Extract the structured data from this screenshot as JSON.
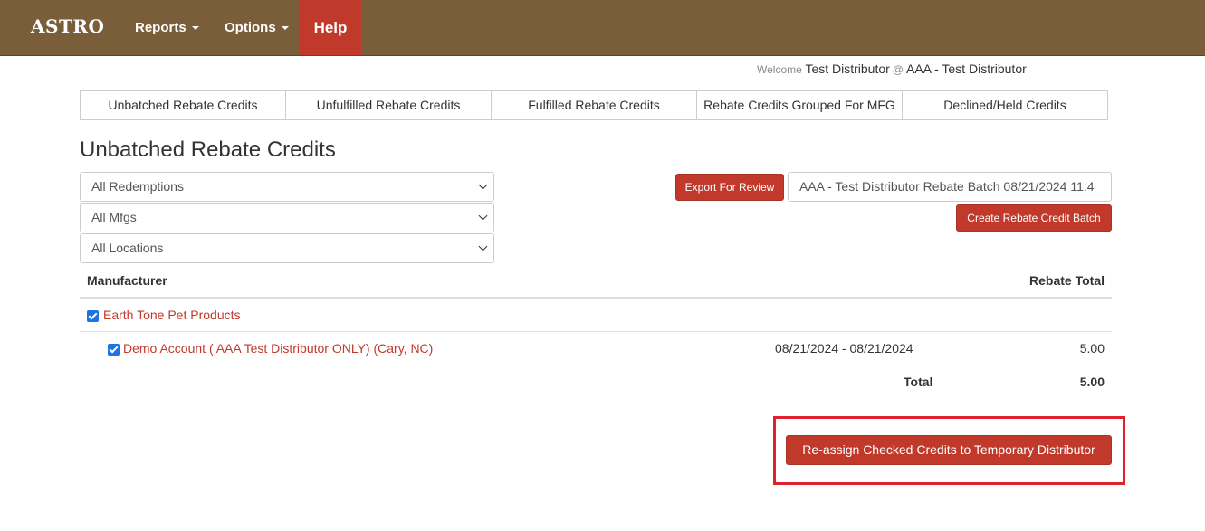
{
  "nav": {
    "brand": "ASTRO",
    "reports": "Reports",
    "options": "Options",
    "help": "Help"
  },
  "welcome": {
    "prefix": "Welcome",
    "user": "Test Distributor",
    "at": "@",
    "org": "AAA - Test Distributor"
  },
  "tabs": [
    {
      "label": "Unbatched Rebate Credits"
    },
    {
      "label": "Unfulfilled Rebate Credits"
    },
    {
      "label": "Fulfilled Rebate Credits"
    },
    {
      "label": "Rebate Credits Grouped For MFG"
    },
    {
      "label": "Declined/Held Credits"
    }
  ],
  "page_title": "Unbatched Rebate Credits",
  "filters": {
    "redemptions": "All Redemptions",
    "mfgs": "All Mfgs",
    "locations": "All Locations"
  },
  "actions": {
    "export": "Export For Review",
    "batch_name": "AAA - Test Distributor  Rebate Batch 08/21/2024 11:4",
    "create_batch": "Create Rebate Credit Batch",
    "reassign": "Re-assign Checked Credits to Temporary Distributor"
  },
  "table": {
    "headers": {
      "manufacturer": "Manufacturer",
      "rebate_total": "Rebate Total"
    },
    "manufacturer_row": {
      "name": "Earth Tone Pet Products",
      "checked": true
    },
    "account_row": {
      "name": "Demo Account ( AAA Test Distributor ONLY) (Cary, NC)",
      "date_range": "08/21/2024 - 08/21/2024",
      "amount": "5.00",
      "checked": true
    },
    "total_row": {
      "label": "Total",
      "amount": "5.00"
    }
  },
  "colors": {
    "navbar": "#7a5e3a",
    "accent_red": "#c0392b",
    "highlight": "#e0202e",
    "checkbox": "#1a73e8"
  }
}
